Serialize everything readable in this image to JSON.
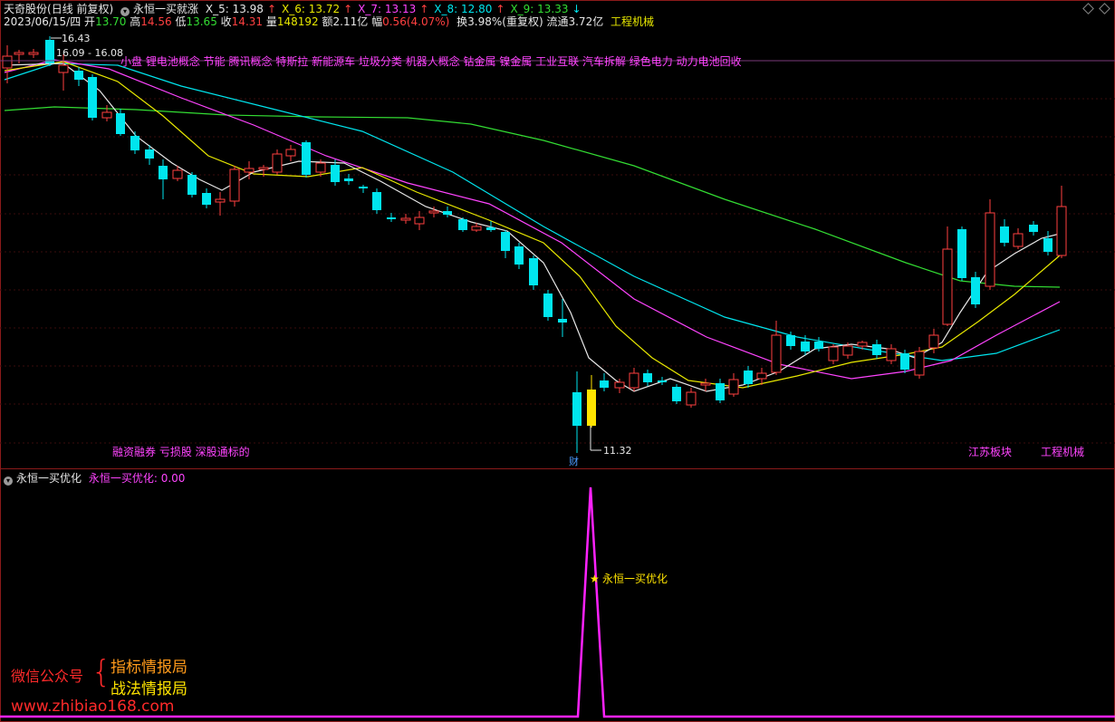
{
  "header": {
    "stock_name": "天奇股份",
    "period": "(日线 前复权)",
    "indicator": "永恒一买就涨",
    "ma_items": [
      {
        "label": "X_5: 13.98",
        "arrow": "↑",
        "color": "#e8e8e8",
        "arrow_color": "#ff4040"
      },
      {
        "label": "X_6: 13.72",
        "arrow": "↑",
        "color": "#e8e800",
        "arrow_color": "#ff4040"
      },
      {
        "label": "X_7: 13.13",
        "arrow": "↑",
        "color": "#ff44ff",
        "arrow_color": "#ff4040"
      },
      {
        "label": "X_8: 12.80",
        "arrow": "↑",
        "color": "#00e5ee",
        "arrow_color": "#ff4040"
      },
      {
        "label": "X_9: 13.33",
        "arrow": "↓",
        "color": "#33dd33",
        "arrow_color": "#00e5ee"
      }
    ],
    "date": "2023/06/15/四",
    "open_label": "开",
    "open": "13.70",
    "high_label": "高",
    "high": "14.56",
    "low_label": "低",
    "low": "13.65",
    "close_label": "收",
    "close": "14.31",
    "vol_label": "量",
    "vol": "148192",
    "amt_label": "额",
    "amt": "2.11亿",
    "chg_label": "幅",
    "chg": "0.56(4.07%)",
    "turnover": "换3.98%(重复权)",
    "float_label": "流通",
    "float": "3.72亿",
    "industry": "工程机械"
  },
  "concepts_top": "小盘 锂电池概念 节能 腾讯概念 特斯拉 新能源车 垃圾分类 机器人概念 钴金属 镍金属 工业互联 汽车拆解 绿色电力 动力电池回收",
  "concepts_bottom": "融资融券 亏损股 深股通标的",
  "right_tag_1": "江苏板块",
  "right_tag_2": "工程机械",
  "price_marks": {
    "high": "16.43",
    "range": "16.09 - 16.08",
    "low": "11.32",
    "fin_label": "财"
  },
  "sub_panel": {
    "title": "永恒一买优化",
    "value_label": "永恒一买优化: 0.00",
    "signal_label": "永恒一买优化"
  },
  "watermark": {
    "line1": "微信公众号",
    "brace": "{",
    "item1": "指标情报局",
    "item2": "战法情报局",
    "url": "www.zhibiao168.com"
  },
  "colors": {
    "up": "#ff4040",
    "down": "#00e5ee",
    "highlight": "#ffe400",
    "ma5": "#e8e8e8",
    "ma10": "#e8e800",
    "ma20": "#ff44ff",
    "ma30": "#00e5ee",
    "ma60": "#33dd33",
    "signal": "#ff22ff"
  }
}
